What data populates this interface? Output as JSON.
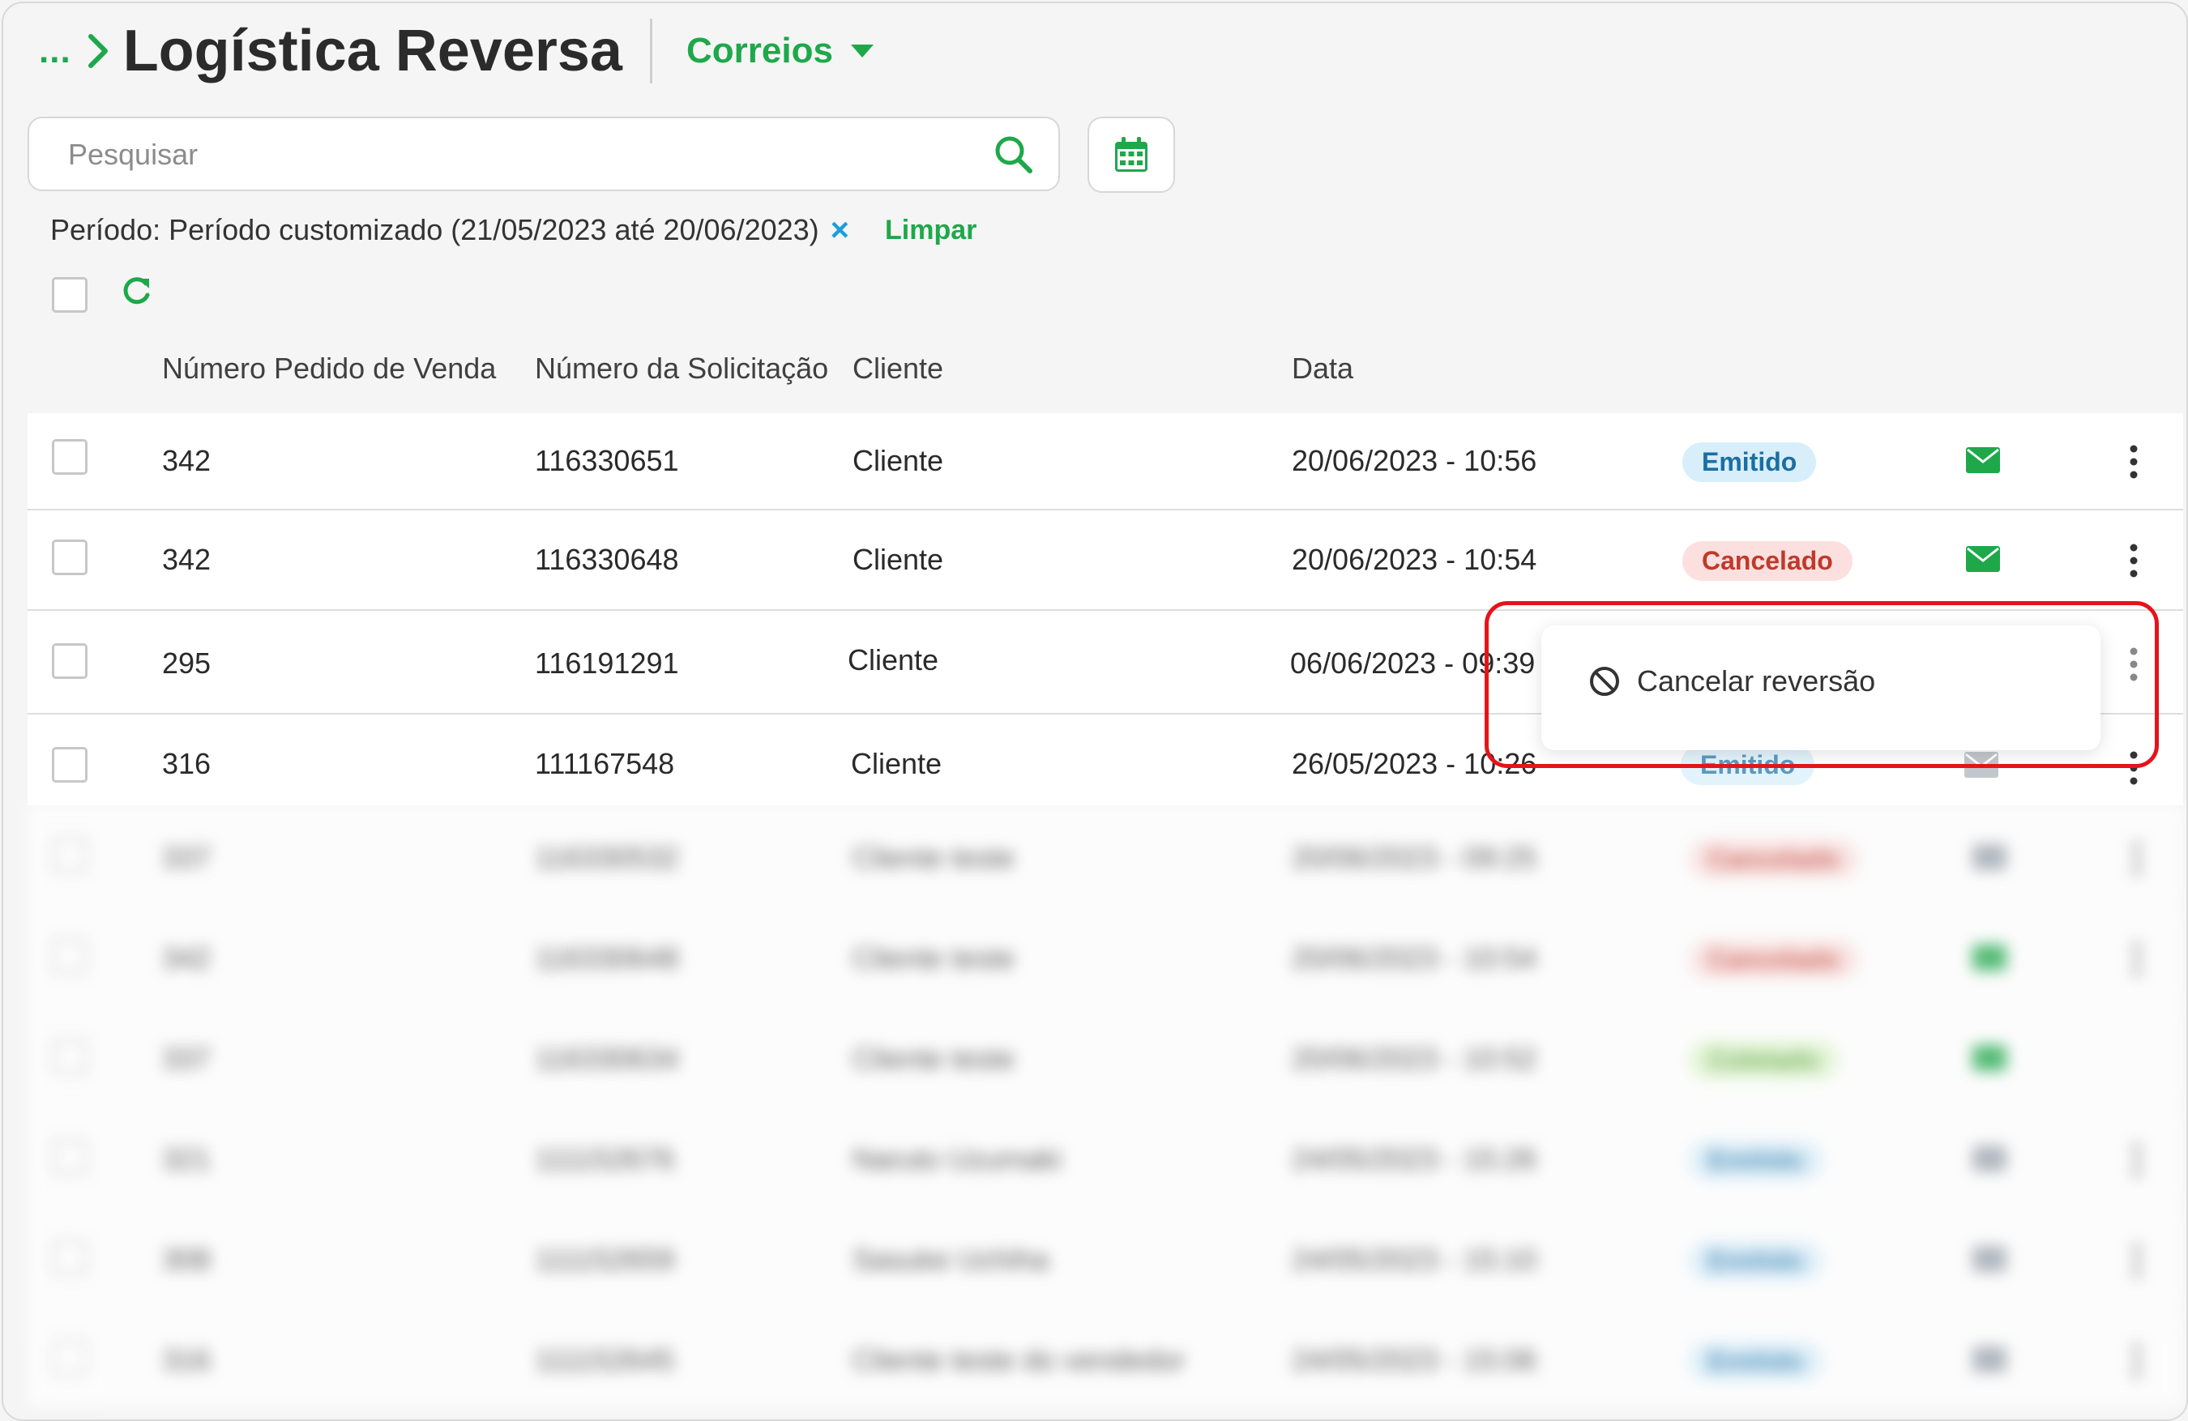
{
  "header": {
    "breadcrumb_dots": "...",
    "title": "Logística Reversa",
    "carrier": "Correios"
  },
  "search": {
    "placeholder": "Pesquisar"
  },
  "filter": {
    "text": "Período: Período customizado (21/05/2023 até 20/06/2023)",
    "remove": "×",
    "clear": "Limpar"
  },
  "table": {
    "columns": [
      "Número Pedido de Venda",
      "Número da Solicitação",
      "Cliente",
      "Data"
    ],
    "rows": [
      {
        "pedido": "342",
        "solicitacao": "116330651",
        "cliente": "Cliente",
        "data": "20/06/2023 - 10:56",
        "status": "Emitido",
        "status_type": "emitido",
        "mail_color": "#1ea84a"
      },
      {
        "pedido": "342",
        "solicitacao": "116330648",
        "cliente": "Cliente",
        "data": "20/06/2023 - 10:54",
        "status": "Cancelado",
        "status_type": "cancelado",
        "mail_color": "#1ea84a"
      },
      {
        "pedido": "295",
        "solicitacao": "116191291",
        "cliente": "Cliente",
        "data": "06/06/2023 - 09:39",
        "status": "",
        "status_type": "",
        "mail_color": ""
      },
      {
        "pedido": "316",
        "solicitacao": "111167548",
        "cliente": "Cliente",
        "data": "26/05/2023 - 10:26",
        "status": "Emitido",
        "status_type": "emitido",
        "mail_color": "#9aa3ad"
      },
      {
        "pedido": "337",
        "solicitacao": "116330532",
        "cliente": "Cliente teste",
        "data": "20/06/2023 - 09:25",
        "status": "Cancelado",
        "status_type": "cancelado",
        "mail_color": "#9aa3ad"
      },
      {
        "pedido": "342",
        "solicitacao": "116330648",
        "cliente": "Cliente teste",
        "data": "20/06/2023 - 10:54",
        "status": "Cancelado",
        "status_type": "cancelado",
        "mail_color": "#1ea84a"
      },
      {
        "pedido": "337",
        "solicitacao": "116330634",
        "cliente": "Cliente teste",
        "data": "20/06/2023 - 10:52",
        "status": "Coletado",
        "status_type": "coletado",
        "mail_color": "#1ea84a"
      },
      {
        "pedido": "321",
        "solicitacao": "111152676",
        "cliente": "Naruto Uzumaki",
        "data": "24/05/2023 - 15:26",
        "status": "Emitido",
        "status_type": "emitido",
        "mail_color": "#9aa3ad"
      },
      {
        "pedido": "308",
        "solicitacao": "111152659",
        "cliente": "Sasuke Uchiha",
        "data": "24/05/2023 - 15:10",
        "status": "Emitido",
        "status_type": "emitido",
        "mail_color": "#9aa3ad"
      },
      {
        "pedido": "316",
        "solicitacao": "111152645",
        "cliente": "Cliente teste do vendedor",
        "data": "24/05/2023 - 15:06",
        "status": "Emitido",
        "status_type": "emitido",
        "mail_color": "#9aa3ad"
      }
    ]
  },
  "popup": {
    "item_label": "Cancelar reversão",
    "icon": "ban-icon"
  },
  "colors": {
    "accent": "#1ea84a",
    "highlight": "#e5141b",
    "link_blue": "#1a9fd8"
  }
}
